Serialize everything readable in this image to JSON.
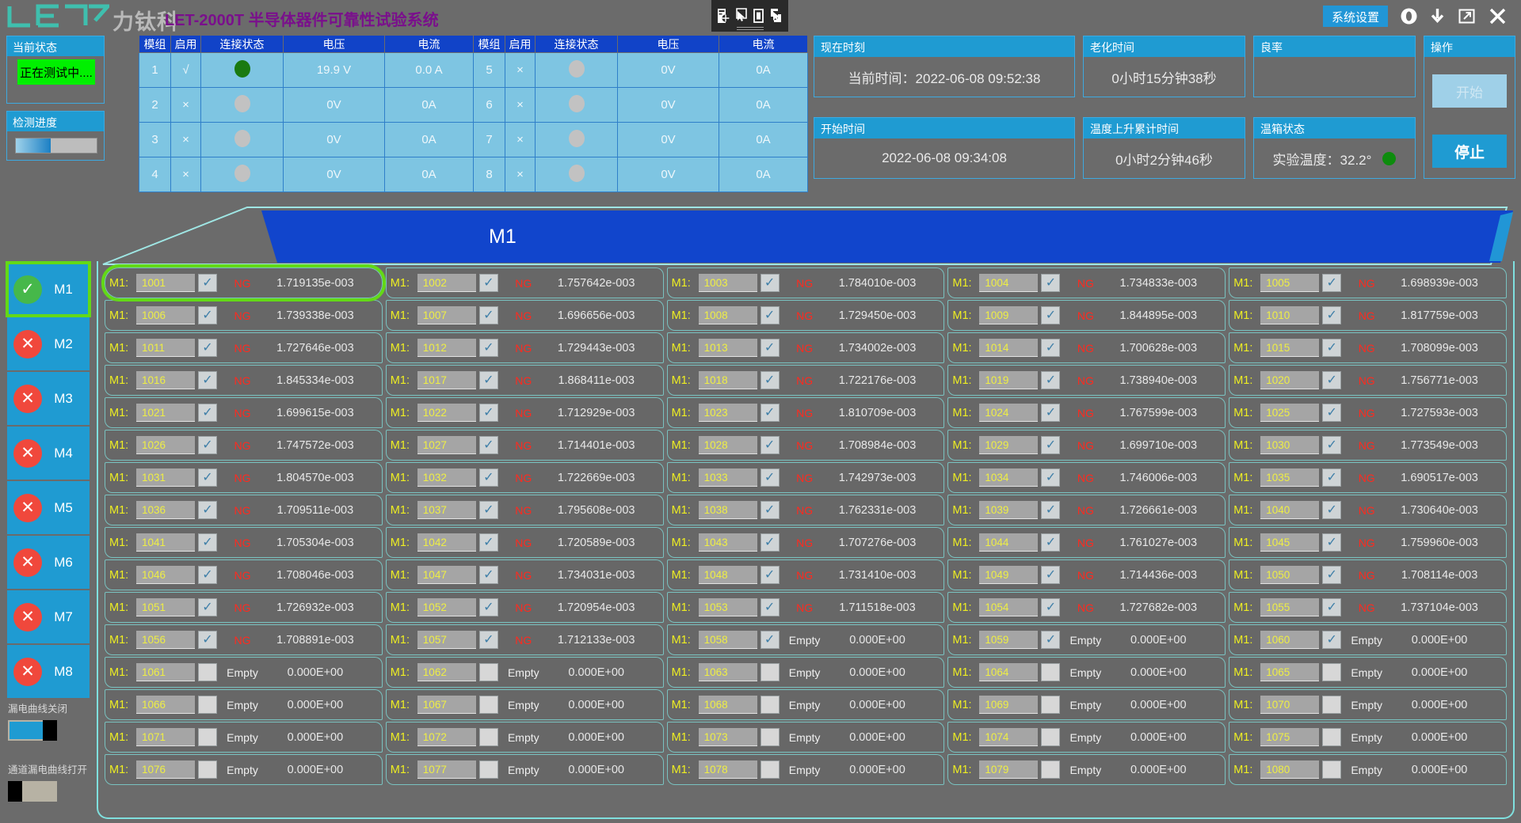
{
  "app": {
    "brand_cn": "力钛科",
    "title": "LET-2000T 半导体器件可靠性试验系统",
    "brand_color": "#7a0f8c",
    "accent_color": "#1f9bd2",
    "logo_name": "let-logo"
  },
  "titlebar": {
    "float_tools": [
      "capture-region-icon",
      "cursor-capture-icon",
      "window-capture-icon",
      "screen-record-icon"
    ],
    "settings_label": "系统设置",
    "icons": [
      "info-icon",
      "download-icon",
      "popout-icon",
      "close-icon"
    ]
  },
  "left": {
    "status_panel": {
      "header": "当前状态",
      "value": "正在测试中....",
      "badge_color": "#00f000"
    },
    "progress_panel": {
      "header": "检测进度",
      "percent": 43
    },
    "modules": [
      {
        "label": "M1",
        "state": "ok",
        "icon": "check-icon",
        "selected": true
      },
      {
        "label": "M2",
        "state": "no",
        "icon": "cross-icon",
        "selected": false
      },
      {
        "label": "M3",
        "state": "no",
        "icon": "cross-icon",
        "selected": false
      },
      {
        "label": "M4",
        "state": "no",
        "icon": "cross-icon",
        "selected": false
      },
      {
        "label": "M5",
        "state": "no",
        "icon": "cross-icon",
        "selected": false
      },
      {
        "label": "M6",
        "state": "no",
        "icon": "cross-icon",
        "selected": false
      },
      {
        "label": "M7",
        "state": "no",
        "icon": "cross-icon",
        "selected": false
      },
      {
        "label": "M8",
        "state": "no",
        "icon": "cross-icon",
        "selected": false
      }
    ],
    "toggles": [
      {
        "label": "漏电曲线关闭",
        "on": true
      },
      {
        "label": "通道漏电曲线打开",
        "on": false
      }
    ]
  },
  "module_table": {
    "columns": [
      "模组",
      "启用",
      "连接状态",
      "电压",
      "电流",
      "模组",
      "启用",
      "连接状态",
      "电压",
      "电流"
    ],
    "rows": [
      [
        "1",
        "√",
        "on",
        "19.9 V",
        "0.0 A",
        "5",
        "×",
        "off",
        "0V",
        "0A"
      ],
      [
        "2",
        "×",
        "off",
        "0V",
        "0A",
        "6",
        "×",
        "off",
        "0V",
        "0A"
      ],
      [
        "3",
        "×",
        "off",
        "0V",
        "0A",
        "7",
        "×",
        "off",
        "0V",
        "0A"
      ],
      [
        "4",
        "×",
        "off",
        "0V",
        "0A",
        "8",
        "×",
        "off",
        "0V",
        "0A"
      ]
    ]
  },
  "info_cards": [
    {
      "id": "now",
      "header": "现在时刻",
      "value": "当前时间：2022-06-08 09:52:38"
    },
    {
      "id": "start",
      "header": "开始时间",
      "value": "2022-06-08 09:34:08"
    },
    {
      "id": "aging",
      "header": "老化时间",
      "value": "0小时15分钟38秒"
    },
    {
      "id": "temprise",
      "header": "温度上升累计时间",
      "value": "0小时2分钟46秒"
    },
    {
      "id": "yield",
      "header": "良率",
      "value": ""
    },
    {
      "id": "oven",
      "header": "温箱状态",
      "value": "实验温度：32.2°",
      "led": "green"
    }
  ],
  "operation": {
    "header": "操作",
    "start_label": "开始",
    "start_disabled": true,
    "stop_label": "停止"
  },
  "banner": {
    "title": "M1"
  },
  "grid": {
    "module_prefix": "M1:",
    "status_ng": "NG",
    "status_empty": "Empty",
    "zero_value": "0.000E+00",
    "selected_channel": "1001",
    "channels": [
      {
        "id": "1001",
        "checked": true,
        "status": "NG",
        "value": "1.719135e-003"
      },
      {
        "id": "1002",
        "checked": true,
        "status": "NG",
        "value": "1.757642e-003"
      },
      {
        "id": "1003",
        "checked": true,
        "status": "NG",
        "value": "1.784010e-003"
      },
      {
        "id": "1004",
        "checked": true,
        "status": "NG",
        "value": "1.734833e-003"
      },
      {
        "id": "1005",
        "checked": true,
        "status": "NG",
        "value": "1.698939e-003"
      },
      {
        "id": "1006",
        "checked": true,
        "status": "NG",
        "value": "1.739338e-003"
      },
      {
        "id": "1007",
        "checked": true,
        "status": "NG",
        "value": "1.696656e-003"
      },
      {
        "id": "1008",
        "checked": true,
        "status": "NG",
        "value": "1.729450e-003"
      },
      {
        "id": "1009",
        "checked": true,
        "status": "NG",
        "value": "1.844895e-003"
      },
      {
        "id": "1010",
        "checked": true,
        "status": "NG",
        "value": "1.817759e-003"
      },
      {
        "id": "1011",
        "checked": true,
        "status": "NG",
        "value": "1.727646e-003"
      },
      {
        "id": "1012",
        "checked": true,
        "status": "NG",
        "value": "1.729443e-003"
      },
      {
        "id": "1013",
        "checked": true,
        "status": "NG",
        "value": "1.734002e-003"
      },
      {
        "id": "1014",
        "checked": true,
        "status": "NG",
        "value": "1.700628e-003"
      },
      {
        "id": "1015",
        "checked": true,
        "status": "NG",
        "value": "1.708099e-003"
      },
      {
        "id": "1016",
        "checked": true,
        "status": "NG",
        "value": "1.845334e-003"
      },
      {
        "id": "1017",
        "checked": true,
        "status": "NG",
        "value": "1.868411e-003"
      },
      {
        "id": "1018",
        "checked": true,
        "status": "NG",
        "value": "1.722176e-003"
      },
      {
        "id": "1019",
        "checked": true,
        "status": "NG",
        "value": "1.738940e-003"
      },
      {
        "id": "1020",
        "checked": true,
        "status": "NG",
        "value": "1.756771e-003"
      },
      {
        "id": "1021",
        "checked": true,
        "status": "NG",
        "value": "1.699615e-003"
      },
      {
        "id": "1022",
        "checked": true,
        "status": "NG",
        "value": "1.712929e-003"
      },
      {
        "id": "1023",
        "checked": true,
        "status": "NG",
        "value": "1.810709e-003"
      },
      {
        "id": "1024",
        "checked": true,
        "status": "NG",
        "value": "1.767599e-003"
      },
      {
        "id": "1025",
        "checked": true,
        "status": "NG",
        "value": "1.727593e-003"
      },
      {
        "id": "1026",
        "checked": true,
        "status": "NG",
        "value": "1.747572e-003"
      },
      {
        "id": "1027",
        "checked": true,
        "status": "NG",
        "value": "1.714401e-003"
      },
      {
        "id": "1028",
        "checked": true,
        "status": "NG",
        "value": "1.708984e-003"
      },
      {
        "id": "1029",
        "checked": true,
        "status": "NG",
        "value": "1.699710e-003"
      },
      {
        "id": "1030",
        "checked": true,
        "status": "NG",
        "value": "1.773549e-003"
      },
      {
        "id": "1031",
        "checked": true,
        "status": "NG",
        "value": "1.804570e-003"
      },
      {
        "id": "1032",
        "checked": true,
        "status": "NG",
        "value": "1.722669e-003"
      },
      {
        "id": "1033",
        "checked": true,
        "status": "NG",
        "value": "1.742973e-003"
      },
      {
        "id": "1034",
        "checked": true,
        "status": "NG",
        "value": "1.746006e-003"
      },
      {
        "id": "1035",
        "checked": true,
        "status": "NG",
        "value": "1.690517e-003"
      },
      {
        "id": "1036",
        "checked": true,
        "status": "NG",
        "value": "1.709511e-003"
      },
      {
        "id": "1037",
        "checked": true,
        "status": "NG",
        "value": "1.795608e-003"
      },
      {
        "id": "1038",
        "checked": true,
        "status": "NG",
        "value": "1.762331e-003"
      },
      {
        "id": "1039",
        "checked": true,
        "status": "NG",
        "value": "1.726661e-003"
      },
      {
        "id": "1040",
        "checked": true,
        "status": "NG",
        "value": "1.730640e-003"
      },
      {
        "id": "1041",
        "checked": true,
        "status": "NG",
        "value": "1.705304e-003"
      },
      {
        "id": "1042",
        "checked": true,
        "status": "NG",
        "value": "1.720589e-003"
      },
      {
        "id": "1043",
        "checked": true,
        "status": "NG",
        "value": "1.707276e-003"
      },
      {
        "id": "1044",
        "checked": true,
        "status": "NG",
        "value": "1.761027e-003"
      },
      {
        "id": "1045",
        "checked": true,
        "status": "NG",
        "value": "1.759960e-003"
      },
      {
        "id": "1046",
        "checked": true,
        "status": "NG",
        "value": "1.708046e-003"
      },
      {
        "id": "1047",
        "checked": true,
        "status": "NG",
        "value": "1.734031e-003"
      },
      {
        "id": "1048",
        "checked": true,
        "status": "NG",
        "value": "1.731410e-003"
      },
      {
        "id": "1049",
        "checked": true,
        "status": "NG",
        "value": "1.714436e-003"
      },
      {
        "id": "1050",
        "checked": true,
        "status": "NG",
        "value": "1.708114e-003"
      },
      {
        "id": "1051",
        "checked": true,
        "status": "NG",
        "value": "1.726932e-003"
      },
      {
        "id": "1052",
        "checked": true,
        "status": "NG",
        "value": "1.720954e-003"
      },
      {
        "id": "1053",
        "checked": true,
        "status": "NG",
        "value": "1.711518e-003"
      },
      {
        "id": "1054",
        "checked": true,
        "status": "NG",
        "value": "1.727682e-003"
      },
      {
        "id": "1055",
        "checked": true,
        "status": "NG",
        "value": "1.737104e-003"
      },
      {
        "id": "1056",
        "checked": true,
        "status": "NG",
        "value": "1.708891e-003"
      },
      {
        "id": "1057",
        "checked": true,
        "status": "NG",
        "value": "1.712133e-003"
      },
      {
        "id": "1058",
        "checked": true,
        "status": "Empty",
        "value": "0.000E+00"
      },
      {
        "id": "1059",
        "checked": true,
        "status": "Empty",
        "value": "0.000E+00"
      },
      {
        "id": "1060",
        "checked": true,
        "status": "Empty",
        "value": "0.000E+00"
      },
      {
        "id": "1061",
        "checked": false,
        "status": "Empty",
        "value": "0.000E+00"
      },
      {
        "id": "1062",
        "checked": false,
        "status": "Empty",
        "value": "0.000E+00"
      },
      {
        "id": "1063",
        "checked": false,
        "status": "Empty",
        "value": "0.000E+00"
      },
      {
        "id": "1064",
        "checked": false,
        "status": "Empty",
        "value": "0.000E+00"
      },
      {
        "id": "1065",
        "checked": false,
        "status": "Empty",
        "value": "0.000E+00"
      },
      {
        "id": "1066",
        "checked": false,
        "status": "Empty",
        "value": "0.000E+00"
      },
      {
        "id": "1067",
        "checked": false,
        "status": "Empty",
        "value": "0.000E+00"
      },
      {
        "id": "1068",
        "checked": false,
        "status": "Empty",
        "value": "0.000E+00"
      },
      {
        "id": "1069",
        "checked": false,
        "status": "Empty",
        "value": "0.000E+00"
      },
      {
        "id": "1070",
        "checked": false,
        "status": "Empty",
        "value": "0.000E+00"
      },
      {
        "id": "1071",
        "checked": false,
        "status": "Empty",
        "value": "0.000E+00"
      },
      {
        "id": "1072",
        "checked": false,
        "status": "Empty",
        "value": "0.000E+00"
      },
      {
        "id": "1073",
        "checked": false,
        "status": "Empty",
        "value": "0.000E+00"
      },
      {
        "id": "1074",
        "checked": false,
        "status": "Empty",
        "value": "0.000E+00"
      },
      {
        "id": "1075",
        "checked": false,
        "status": "Empty",
        "value": "0.000E+00"
      },
      {
        "id": "1076",
        "checked": false,
        "status": "Empty",
        "value": "0.000E+00"
      },
      {
        "id": "1077",
        "checked": false,
        "status": "Empty",
        "value": "0.000E+00"
      },
      {
        "id": "1078",
        "checked": false,
        "status": "Empty",
        "value": "0.000E+00"
      },
      {
        "id": "1079",
        "checked": false,
        "status": "Empty",
        "value": "0.000E+00"
      },
      {
        "id": "1080",
        "checked": false,
        "status": "Empty",
        "value": "0.000E+00"
      }
    ]
  }
}
